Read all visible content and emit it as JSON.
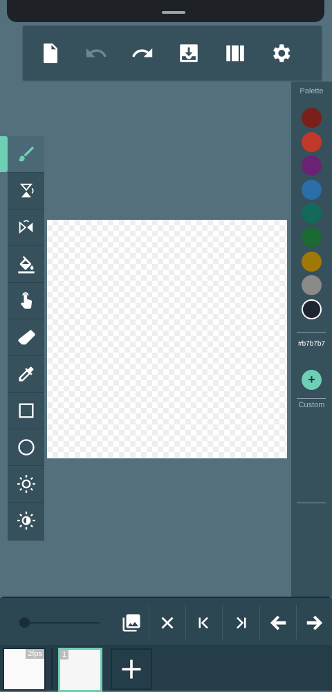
{
  "toolbar": {
    "buttons": [
      {
        "name": "new-file",
        "icon": "file-icon"
      },
      {
        "name": "undo",
        "icon": "undo-icon",
        "disabled": true
      },
      {
        "name": "redo",
        "icon": "redo-icon"
      },
      {
        "name": "save",
        "icon": "download-icon"
      },
      {
        "name": "frames",
        "icon": "film-icon"
      },
      {
        "name": "settings",
        "icon": "gear-icon"
      }
    ]
  },
  "tools": [
    {
      "name": "brush",
      "icon": "brush-icon",
      "active": true
    },
    {
      "name": "flip-vertical",
      "icon": "flip-vertical-icon"
    },
    {
      "name": "flip-horizontal",
      "icon": "flip-horizontal-icon"
    },
    {
      "name": "fill",
      "icon": "paint-bucket-icon"
    },
    {
      "name": "pan",
      "icon": "hand-pointer-icon"
    },
    {
      "name": "eraser",
      "icon": "eraser-icon"
    },
    {
      "name": "eyedropper",
      "icon": "eyedropper-icon"
    },
    {
      "name": "rectangle",
      "icon": "square-icon"
    },
    {
      "name": "circle",
      "icon": "circle-icon"
    },
    {
      "name": "brightness",
      "icon": "sun-icon"
    },
    {
      "name": "contrast",
      "icon": "half-sun-icon"
    }
  ],
  "palette": {
    "title": "Palette",
    "colors": [
      "#7a1f1a",
      "#c0392b",
      "#6a2273",
      "#2b6fa8",
      "#136a5a",
      "#1b6a32",
      "#a07807",
      "#8a8a8a",
      "#1e2530"
    ],
    "selected_index": 8,
    "hex": "#b7b7b7",
    "add_label": "+",
    "custom_label": "Custom"
  },
  "timeline": {
    "fps_label": "2fps",
    "frames": [
      {
        "label": "1"
      }
    ],
    "slider_value": 0
  }
}
